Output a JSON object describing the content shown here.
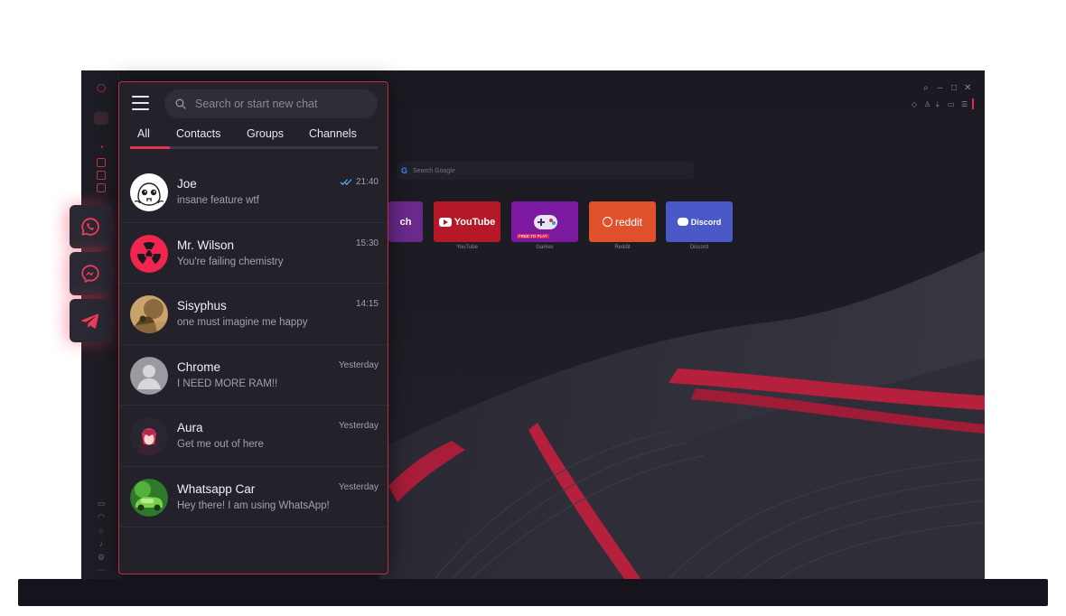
{
  "search": {
    "placeholder": "Search or start new chat"
  },
  "tabs": [
    {
      "label": "All",
      "active": true
    },
    {
      "label": "Contacts",
      "active": false
    },
    {
      "label": "Groups",
      "active": false
    },
    {
      "label": "Channels",
      "active": false
    }
  ],
  "chats": [
    {
      "name": "Joe",
      "message": "insane feature wtf",
      "time": "21:40",
      "read": true
    },
    {
      "name": "Mr. Wilson",
      "message": "You're failing chemistry",
      "time": "15:30"
    },
    {
      "name": "Sisyphus",
      "message": "one must imagine me happy",
      "time": "14:15"
    },
    {
      "name": "Chrome",
      "message": "I NEED MORE RAM!!",
      "time": "Yesterday"
    },
    {
      "name": "Aura",
      "message": "Get me out of here",
      "time": "Yesterday"
    },
    {
      "name": "Whatsapp Car",
      "message": "Hey there! I am using WhatsApp!",
      "time": "Yesterday"
    }
  ],
  "browser": {
    "search_placeholder": "Search Google",
    "speed_dial": [
      {
        "label": "YouTube",
        "tile_text": "YouTube"
      },
      {
        "label": "Games",
        "tile_text": "FREE TO PLAY"
      },
      {
        "label": "Reddit",
        "tile_text": "reddit"
      },
      {
        "label": "Discord",
        "tile_text": "Discord"
      }
    ],
    "partial_tile_text": "ch"
  },
  "colors": {
    "accent": "#e8334f",
    "panel": "#23222b",
    "screen": "#1b1a22"
  }
}
